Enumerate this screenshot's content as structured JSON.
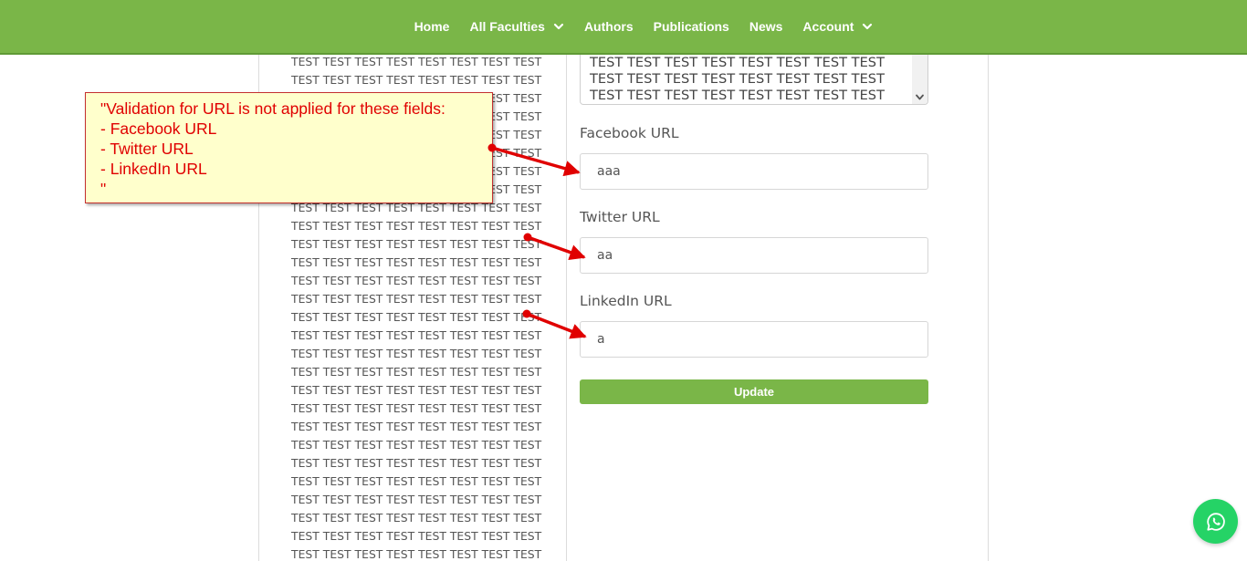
{
  "colors": {
    "nav_bg": "#7ab648",
    "button_bg": "#7ab648",
    "annotation_text": "#e00000",
    "annotation_bg": "#ffffcc",
    "whatsapp": "#25d366"
  },
  "nav": {
    "items": [
      {
        "label": "Home",
        "dropdown": false
      },
      {
        "label": "All Faculties",
        "dropdown": true
      },
      {
        "label": "Authors",
        "dropdown": false
      },
      {
        "label": "Publications",
        "dropdown": false
      },
      {
        "label": "News",
        "dropdown": false
      },
      {
        "label": "Account",
        "dropdown": true
      }
    ]
  },
  "left_text": {
    "line": "TEST TEST TEST TEST TEST TEST TEST TEST",
    "visible_lines": 28
  },
  "form": {
    "textarea": {
      "lines": [
        "TEST TEST TEST TEST TEST TEST TEST TEST",
        "TEST TEST TEST TEST TEST TEST TEST TEST",
        "TEST TEST TEST TEST TEST TEST TEST TEST"
      ]
    },
    "facebook": {
      "label": "Facebook URL",
      "value": "aaa"
    },
    "twitter": {
      "label": "Twitter URL",
      "value": "aa"
    },
    "linkedin": {
      "label": "LinkedIn URL",
      "value": "a"
    },
    "update_label": "Update"
  },
  "annotation": {
    "lines": [
      "\"Validation for URL is not applied for these fields:",
      "- Facebook URL",
      "- Twitter URL",
      "- LinkedIn URL",
      "\""
    ]
  },
  "icons": {
    "nav_dropdown": "chevron-down-icon",
    "textarea_scroll": "scroll-down-arrow-icon",
    "floating_chat": "whatsapp-icon"
  }
}
